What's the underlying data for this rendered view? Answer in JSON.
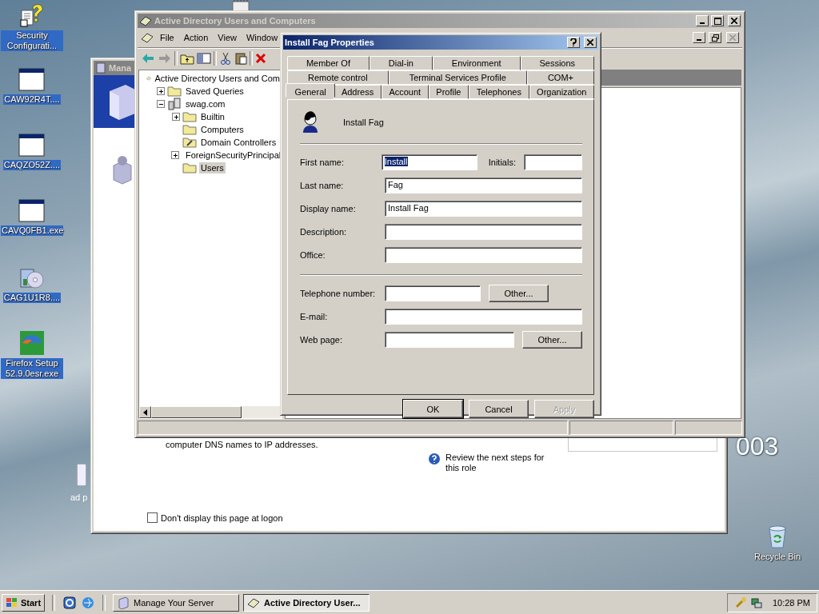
{
  "desktop": {
    "icons": [
      {
        "kind": "help",
        "label": "Security Configurati...",
        "selected": true
      },
      {
        "kind": "app",
        "label": "CAW92R4T....",
        "selected": true
      },
      {
        "kind": "app",
        "label": "CAQZO52Z....",
        "selected": true
      },
      {
        "kind": "app",
        "label": "CAVQ0FB1.exe",
        "selected": true
      },
      {
        "kind": "installer",
        "label": "CAG1U1R8....",
        "selected": true
      },
      {
        "kind": "firefox",
        "label": "Firefox Setup 52.9.0esr.exe",
        "selected": true
      }
    ],
    "partial_icon_label": "ad p",
    "wallpaper_text": "003",
    "recycle_bin": {
      "label": "Recycle Bin",
      "selected": false
    }
  },
  "manage_window": {
    "title": "Mana",
    "description": "computer DNS names to IP addresses.",
    "next_steps_link": "Review the next steps for this role",
    "logon_checkbox": {
      "label": "Don't display this page at logon",
      "checked": false
    }
  },
  "aduc_window": {
    "title": "Active Directory Users and Computers",
    "menu": [
      "File",
      "Action",
      "View",
      "Window"
    ],
    "tree": [
      {
        "label": "Active Directory Users and Com",
        "kind": "snapin",
        "selected": false,
        "children": [
          {
            "label": "Saved Queries",
            "kind": "folder",
            "expanded": false,
            "selected": false
          },
          {
            "label": "swag.com",
            "kind": "domain",
            "expanded": true,
            "selected": false,
            "children": [
              {
                "label": "Builtin",
                "kind": "folder",
                "expanded": false,
                "selected": false
              },
              {
                "label": "Computers",
                "kind": "folder",
                "selected": false
              },
              {
                "label": "Domain Controllers",
                "kind": "ou",
                "selected": false
              },
              {
                "label": "ForeignSecurityPrincipal",
                "kind": "folder",
                "expanded": false,
                "selected": false
              },
              {
                "label": "Users",
                "kind": "folder",
                "selected": true
              }
            ]
          }
        ]
      }
    ]
  },
  "dialog": {
    "title": "Install Fag Properties",
    "tab_rows": [
      [
        {
          "label": "Member Of",
          "selected": false
        },
        {
          "label": "Dial-in",
          "selected": false
        },
        {
          "label": "Environment",
          "selected": false
        },
        {
          "label": "Sessions",
          "selected": false
        }
      ],
      [
        {
          "label": "Remote control",
          "selected": false
        },
        {
          "label": "Terminal Services Profile",
          "selected": false
        },
        {
          "label": "COM+",
          "selected": false
        }
      ],
      [
        {
          "label": "General",
          "selected": true
        },
        {
          "label": "Address",
          "selected": false
        },
        {
          "label": "Account",
          "selected": false
        },
        {
          "label": "Profile",
          "selected": false
        },
        {
          "label": "Telephones",
          "selected": false
        },
        {
          "label": "Organization",
          "selected": false
        }
      ]
    ],
    "user_name": "Install Fag",
    "field_groups": [
      [
        {
          "label": "First name:",
          "value": "Install",
          "text_selected": true,
          "side": {
            "kind": "field",
            "label": "Initials:"
          }
        },
        {
          "label": "Last name:",
          "value": "Fag",
          "text_selected": false
        },
        {
          "label": "Display name:",
          "value": "Install Fag",
          "text_selected": false
        },
        {
          "label": "Description:"
        },
        {
          "label": "Office:"
        }
      ],
      [
        {
          "label": "Telephone number:",
          "side": {
            "kind": "button",
            "label": "Other..."
          }
        },
        {
          "label": "E-mail:"
        },
        {
          "label": "Web page:",
          "side": {
            "kind": "button",
            "label": "Other..."
          }
        }
      ]
    ],
    "buttons": [
      {
        "label": "OK",
        "default": true,
        "disabled": false
      },
      {
        "label": "Cancel",
        "default": false,
        "disabled": false
      },
      {
        "label": "Apply",
        "default": false,
        "disabled": true
      }
    ]
  },
  "taskbar": {
    "start": "Start",
    "tasks": [
      {
        "label": "Manage Your Server",
        "kind": "server",
        "selected": false
      },
      {
        "label": "Active Directory User...",
        "kind": "aduc",
        "selected": true
      }
    ],
    "clock": "10:28 PM"
  }
}
